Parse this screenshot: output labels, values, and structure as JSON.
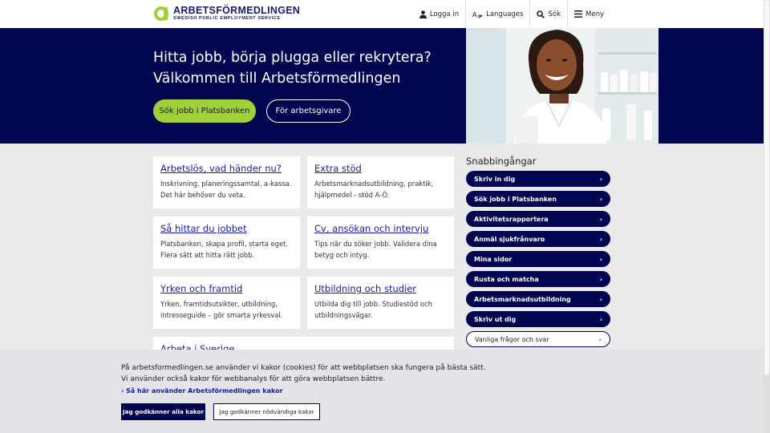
{
  "header": {
    "logo_name": "ARBETSFÖRMEDLINGEN",
    "logo_sub": "SWEDISH PUBLIC EMPLOYMENT SERVICE",
    "nav": [
      {
        "label": "Logga in",
        "icon": "user-icon"
      },
      {
        "label": "Languages",
        "icon": "translate-icon"
      },
      {
        "label": "Sök",
        "icon": "search-icon"
      },
      {
        "label": "Meny",
        "icon": "menu-icon"
      }
    ]
  },
  "hero": {
    "title_line1": "Hitta jobb, börja plugga eller rekrytera?",
    "title_line2": "Välkommen till Arbetsförmedlingen",
    "primary_button": "Sök jobb i Platsbanken",
    "secondary_button": "För arbetsgivare"
  },
  "cards": [
    {
      "title": "Arbetslös, vad händer nu?",
      "line1": "Inskrivning, planeringssamtal, a-kassa.",
      "line2": "Det här behöver du veta."
    },
    {
      "title": "Extra stöd",
      "line1": "Arbetsmarknadsutbildning, praktik,",
      "line2": "hjälpmedel - stöd A-Ö."
    },
    {
      "title": "Så hittar du jobbet",
      "line1": "Platsbanken, skapa profil, starta eget.",
      "line2": "Flera sätt att hitta rätt jobb."
    },
    {
      "title": "Cv, ansökan och intervju",
      "line1": "Tips när du söker jobb. Validera dina",
      "line2": "betyg och intyg."
    },
    {
      "title": "Yrken och framtid",
      "line1": "Yrken, framtidsutsikter, utbildning,",
      "line2": "intresseguide – gör smarta yrkesval."
    },
    {
      "title": "Utbildning och studier",
      "line1": "Utbilda dig till jobb. Studiestöd och",
      "line2": "utbildningsvägar."
    },
    {
      "title": "Arbeta i Sverige",
      "line1": "",
      "line2": ""
    }
  ],
  "quicklinks": {
    "title": "Snabbingångar",
    "items": [
      "Skriv in dig",
      "Sök jobb i Platsbanken",
      "Aktivitetsrapportera",
      "Anmäl sjukfrånvaro",
      "Mina sidor",
      "Rusta och matcha",
      "Arbetsmarknadsutbildning",
      "Skriv ut dig",
      "Vanliga frågor och svar"
    ]
  },
  "cookie": {
    "line1": "På arbetsformedlingen.se använder vi kakor (cookies) för att webbplatsen ska fungera på bästa sätt.",
    "line2": "Vi använder också kakor för webbanalys för att göra webbplatsen bättre.",
    "link": "Så här använder Arbetsförmedlingen kakor",
    "accept_all": "Jag godkänner alla kakor",
    "accept_necessary": "Jag godkänner nödvändiga kakor"
  },
  "colors": {
    "navy": "#020550",
    "green": "#9fd13a",
    "link": "#1a1aa6"
  }
}
